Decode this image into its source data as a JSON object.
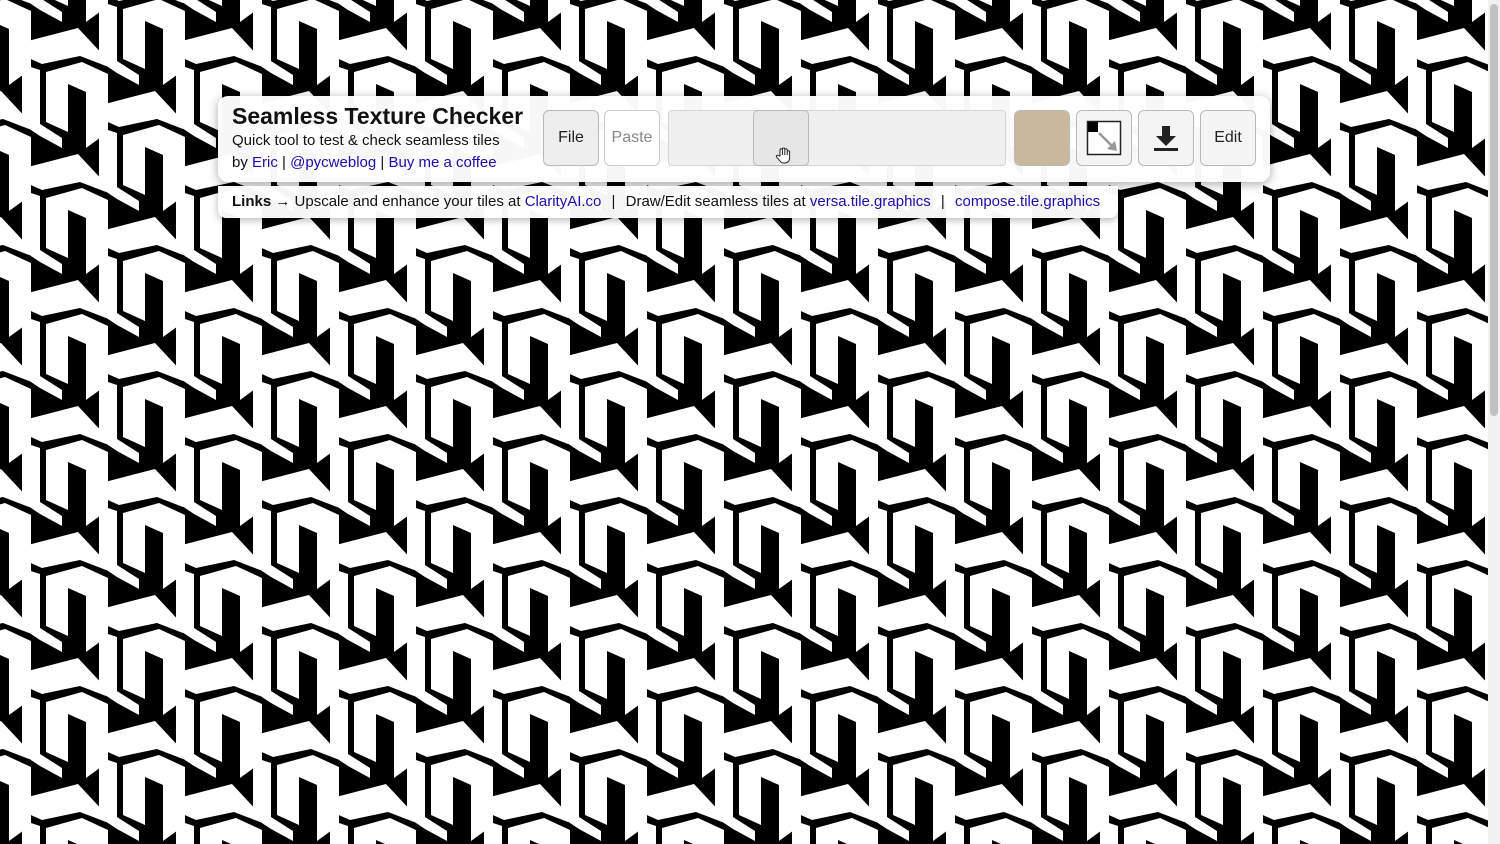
{
  "app": {
    "title": "Seamless Texture Checker",
    "subtitle": "Quick tool to test & check seamless tiles",
    "by_prefix": "by",
    "author_link": "Eric",
    "separator": "|",
    "twitter_link": "@pycweblog",
    "coffee_link": "Buy me a coffee"
  },
  "toolbar": {
    "file_label": "File",
    "paste_label": "Paste",
    "slider_value": 0.3,
    "background_color": "#c9b99c",
    "fit_icon": "corner-resize-icon",
    "download_icon": "download-icon",
    "edit_label": "Edit"
  },
  "links": {
    "heading": "Links",
    "arrow": "→",
    "text1": "Upscale and enhance your tiles at",
    "link1": "ClarityAI.co",
    "text2": "Draw/Edit seamless tiles at",
    "link2": "versa.tile.graphics",
    "link3": "compose.tile.graphics",
    "separator": "|"
  },
  "colors": {
    "pattern_fg": "#ffffff",
    "pattern_bg": "#000000",
    "link": "#1a0dab"
  }
}
